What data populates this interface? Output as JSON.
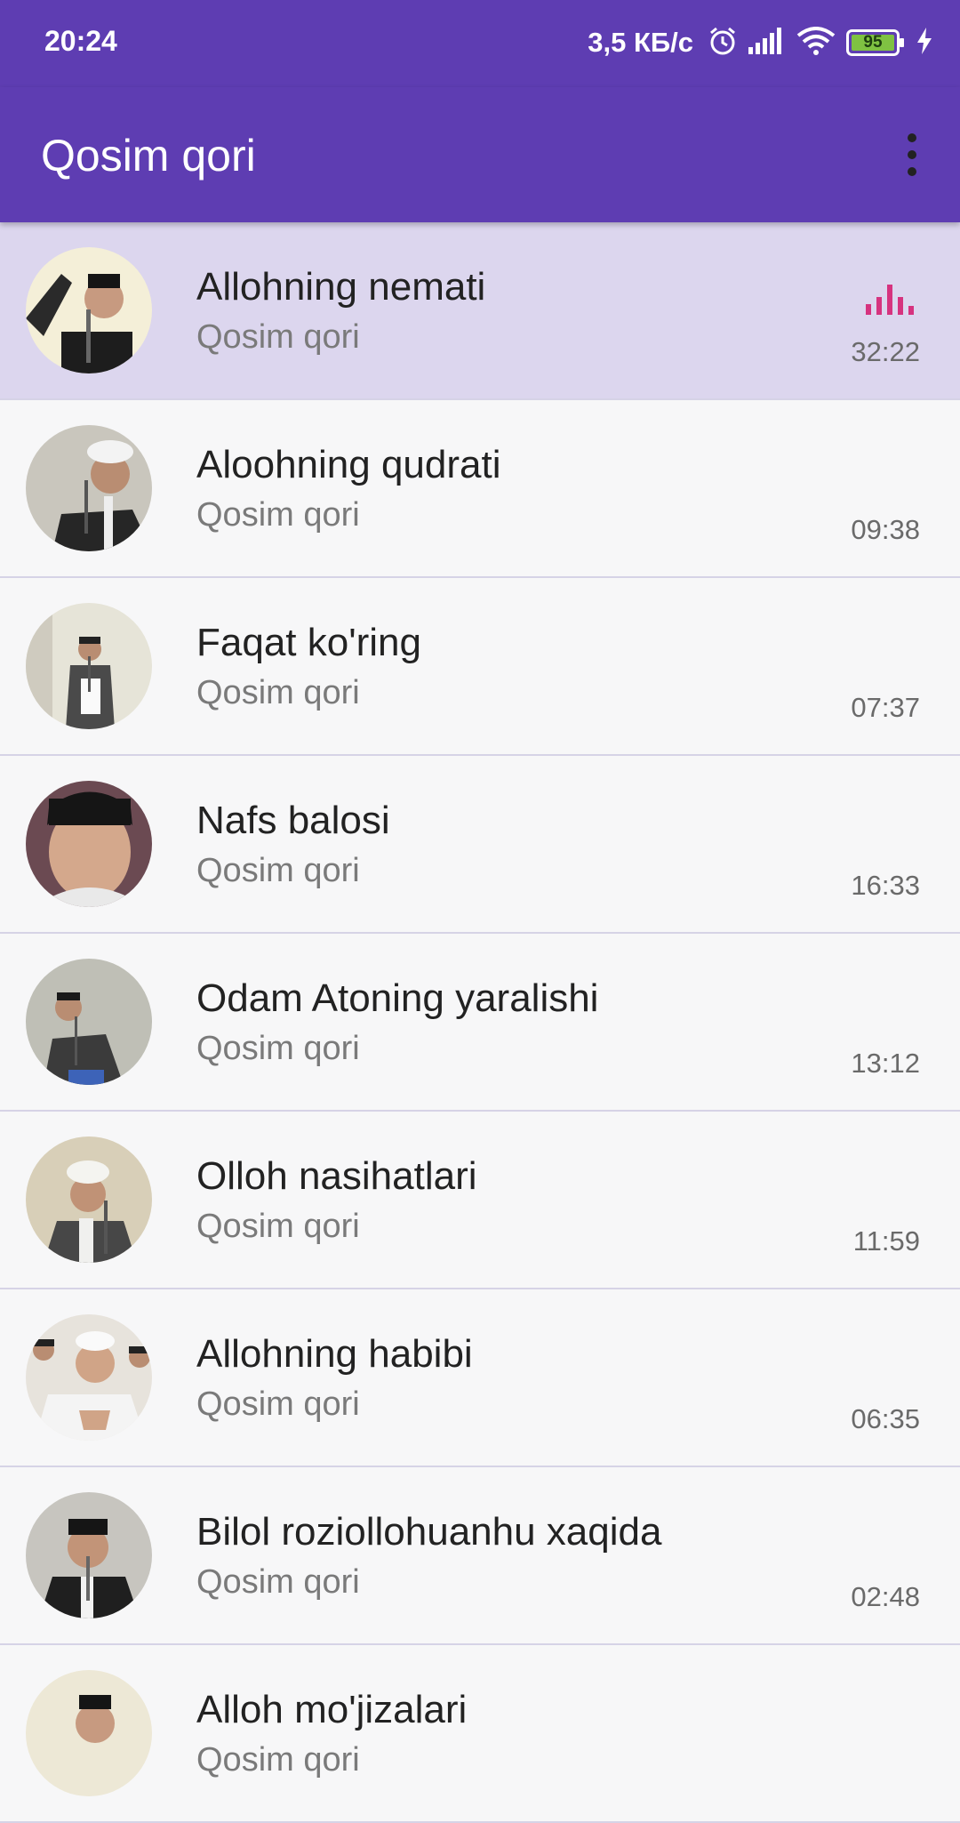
{
  "status_bar": {
    "time": "20:24",
    "speed": "3,5 КБ/с",
    "battery": "95",
    "icons": [
      "alarm-icon",
      "signal-icon",
      "wifi-icon",
      "battery-icon",
      "charging-icon"
    ]
  },
  "app_bar": {
    "title": "Qosim qori",
    "menu_icon": "overflow-menu-icon"
  },
  "colors": {
    "primary": "#5e3db2",
    "active_row": "#dcd6ee",
    "equalizer": "#d6337f"
  },
  "tracks": [
    {
      "title": "Allohning nemati",
      "artist": "Qosim qori",
      "duration": "32:22",
      "playing": true
    },
    {
      "title": "Aloohning qudrati",
      "artist": "Qosim qori",
      "duration": "09:38"
    },
    {
      "title": "Faqat ko'ring",
      "artist": "Qosim qori",
      "duration": "07:37"
    },
    {
      "title": "Nafs balosi",
      "artist": "Qosim qori",
      "duration": "16:33"
    },
    {
      "title": "Odam Atoning yaralishi",
      "artist": "Qosim qori",
      "duration": "13:12"
    },
    {
      "title": "Olloh nasihatlari",
      "artist": "Qosim qori",
      "duration": "11:59"
    },
    {
      "title": "Allohning habibi",
      "artist": "Qosim qori",
      "duration": "06:35"
    },
    {
      "title": "Bilol roziollohuanhu xaqida",
      "artist": "Qosim qori",
      "duration": "02:48"
    },
    {
      "title": "Alloh mo'jizalari",
      "artist": "Qosim qori",
      "duration": ""
    }
  ]
}
